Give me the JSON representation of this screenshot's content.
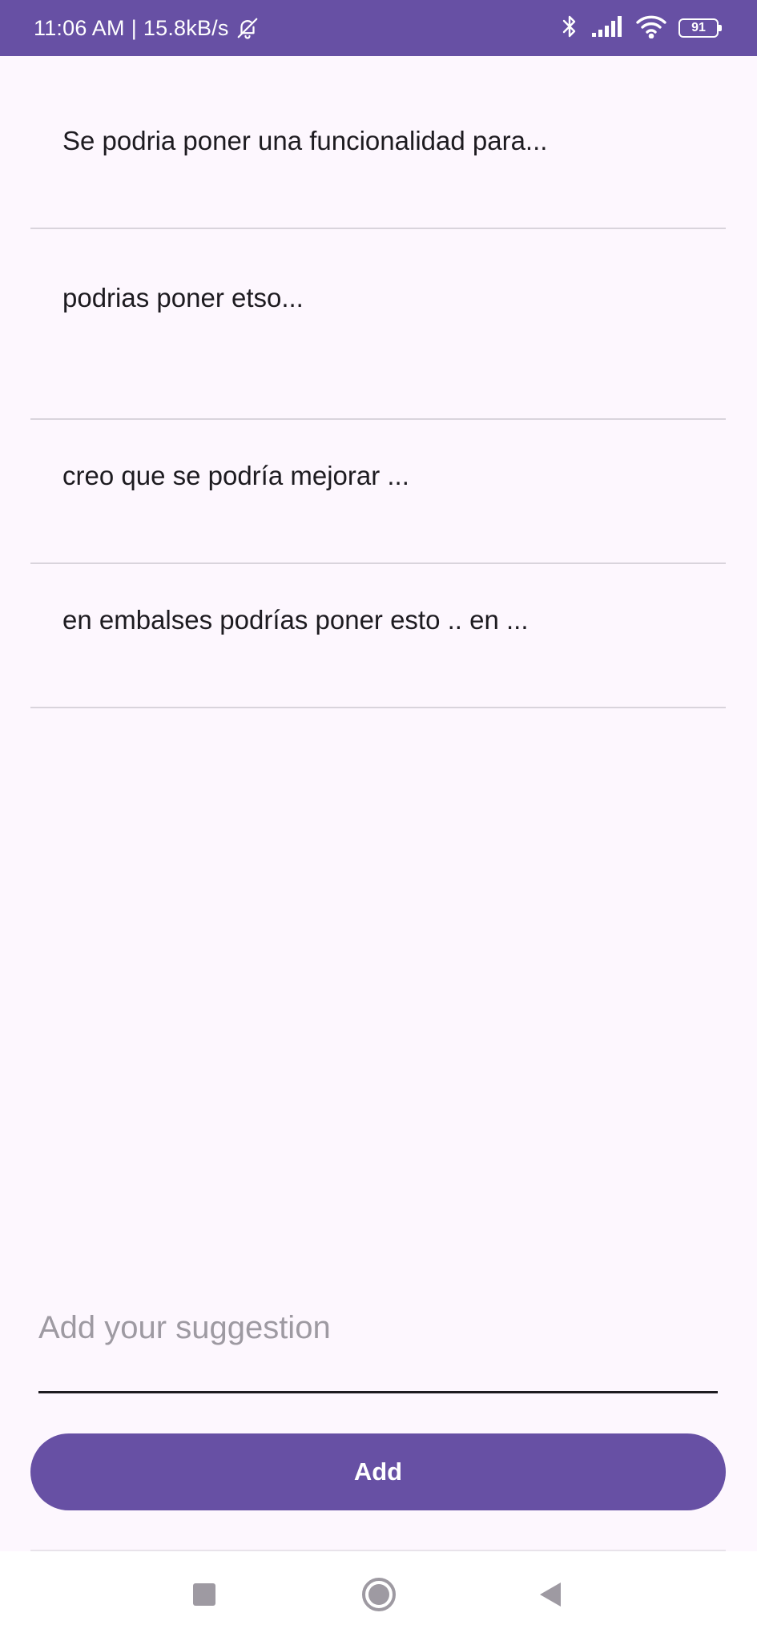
{
  "status_bar": {
    "time": "11:06 AM",
    "separator": "|",
    "net_speed": "15.8kB/s",
    "battery": "91",
    "icons": [
      "bell-off-icon",
      "bluetooth-icon",
      "signal-icon",
      "wifi-icon",
      "battery-icon"
    ]
  },
  "suggestions": [
    {
      "text": "Se podria poner una funcionalidad para..."
    },
    {
      "text": "podrias poner etso..."
    },
    {
      "text": "creo que se podría mejorar ..."
    },
    {
      "text": "en embalses podrías poner esto .. en ..."
    }
  ],
  "input": {
    "placeholder": "Add your suggestion",
    "value": ""
  },
  "add_button": {
    "label": "Add"
  },
  "navigation": {
    "icons": [
      "recents-icon",
      "home-icon",
      "back-icon"
    ]
  },
  "colors": {
    "primary": "#6750A4",
    "background": "#FDF7FE",
    "text": "#1D1B20",
    "divider": "#D9D4DC",
    "placeholder": "#9E9AA2"
  }
}
